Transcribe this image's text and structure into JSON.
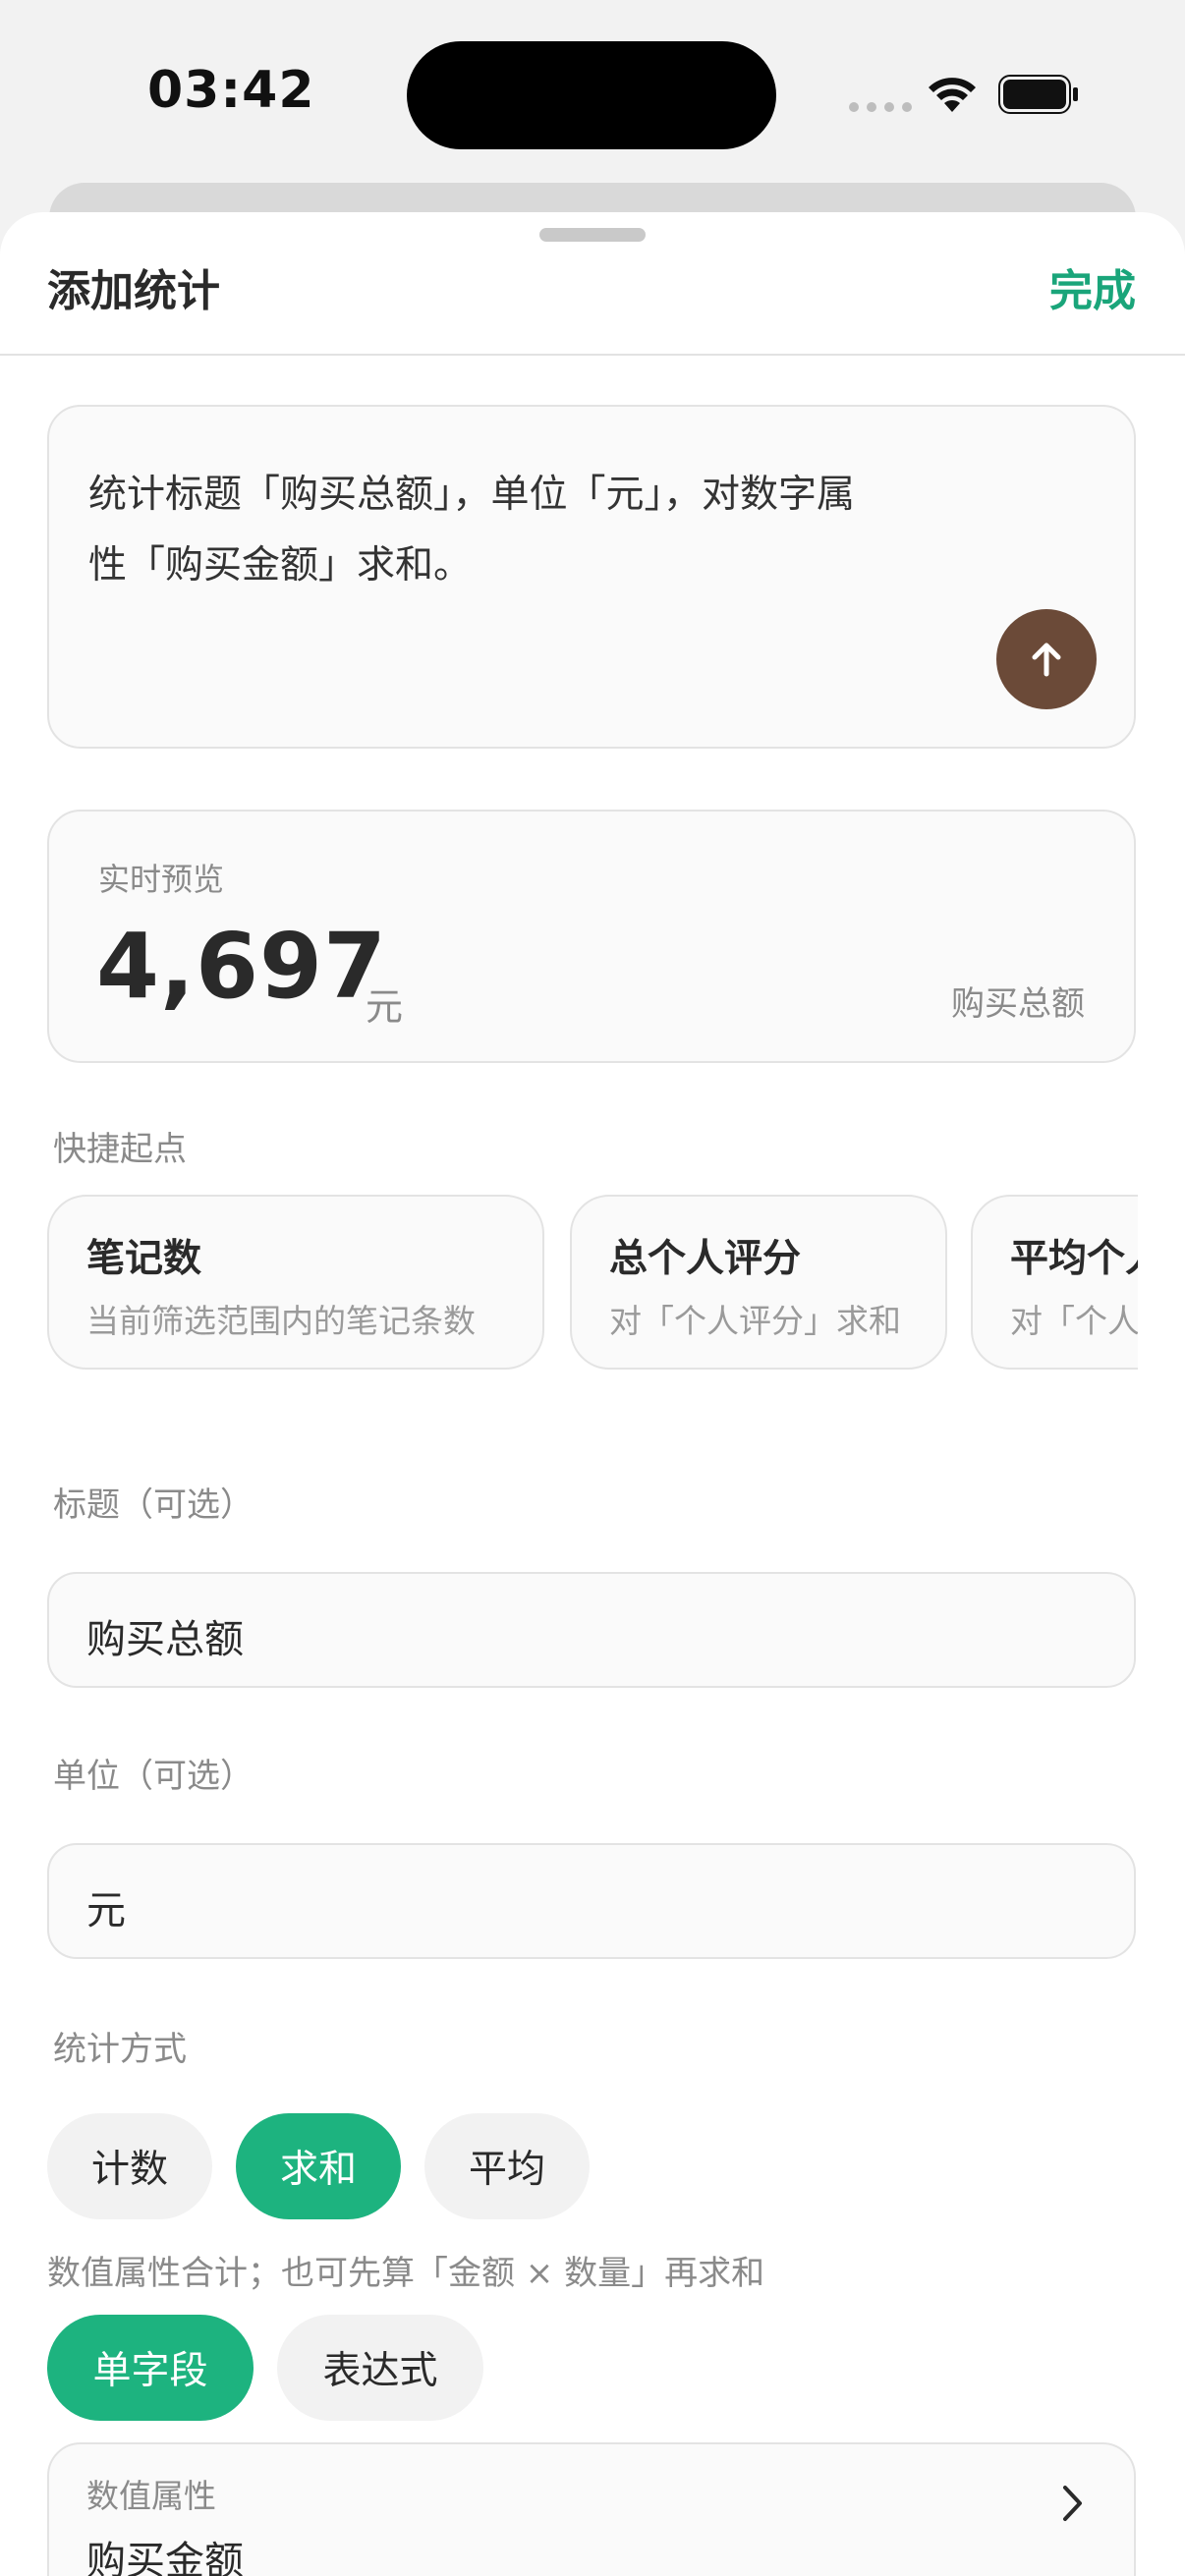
{
  "status_bar": {
    "time": "03:42"
  },
  "sheet": {
    "title": "添加统计",
    "done_label": "完成"
  },
  "prompt": {
    "line1": "统计标题「购买总额」，单位「元」，对数字属",
    "line2": "性「购买金额」求和。"
  },
  "preview": {
    "label": "实时预览",
    "value": "4,697",
    "unit": "元",
    "name": "购买总额"
  },
  "quick_start": {
    "label": "快捷起点",
    "items": [
      {
        "title": "笔记数",
        "subtitle": "当前筛选范围内的笔记条数"
      },
      {
        "title": "总个人评分",
        "subtitle": "对「个人评分」求和"
      },
      {
        "title": "平均个人评分",
        "subtitle": "对「个人评分」求平均"
      }
    ]
  },
  "title_field": {
    "label": "标题（可选）",
    "value": "购买总额"
  },
  "unit_field": {
    "label": "单位（可选）",
    "value": "元"
  },
  "method": {
    "label": "统计方式",
    "options": [
      "计数",
      "求和",
      "平均"
    ],
    "selected": "求和",
    "hint": "数值属性合计；也可先算「金额 × 数量」再求和"
  },
  "mode": {
    "options": [
      "单字段",
      "表达式"
    ],
    "selected": "单字段"
  },
  "property": {
    "label": "数值属性",
    "value": "购买金额"
  },
  "colors": {
    "accent": "#1db37f",
    "send_button": "#6b4a38"
  }
}
